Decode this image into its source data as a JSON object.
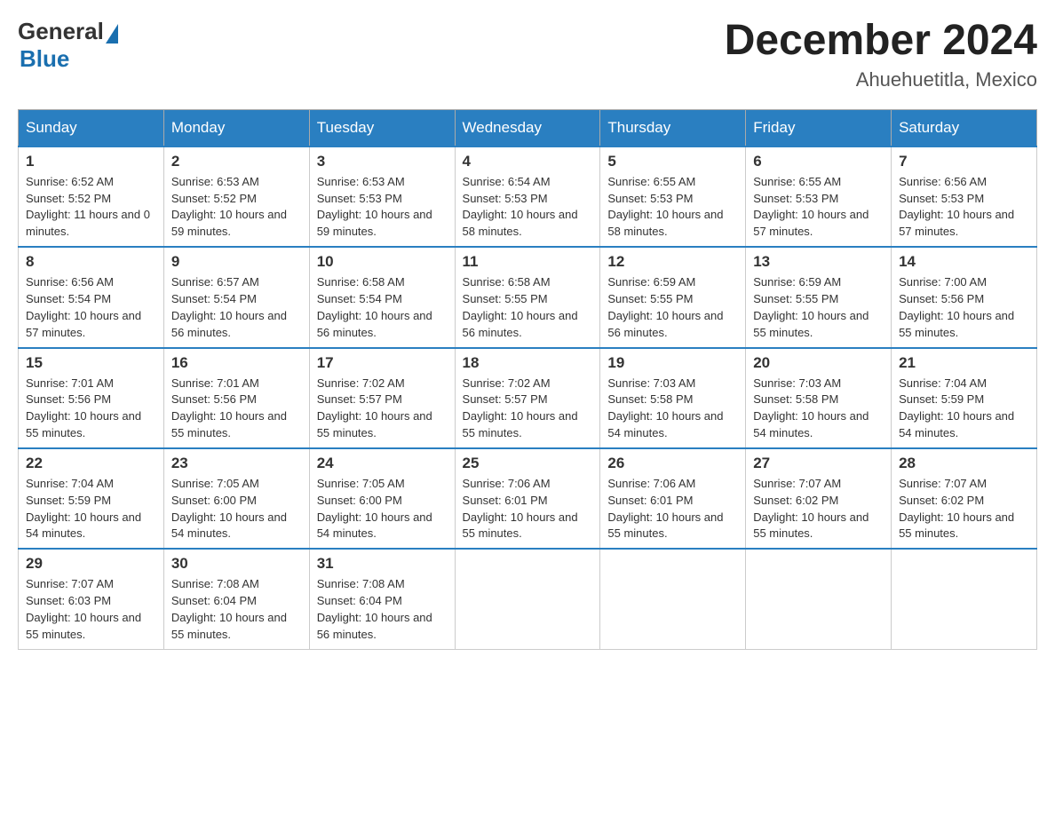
{
  "header": {
    "logo": {
      "general": "General",
      "blue": "Blue"
    },
    "title": "December 2024",
    "location": "Ahuehuetitla, Mexico"
  },
  "days_of_week": [
    "Sunday",
    "Monday",
    "Tuesday",
    "Wednesday",
    "Thursday",
    "Friday",
    "Saturday"
  ],
  "weeks": [
    [
      {
        "day": "1",
        "sunrise": "6:52 AM",
        "sunset": "5:52 PM",
        "daylight": "11 hours and 0 minutes."
      },
      {
        "day": "2",
        "sunrise": "6:53 AM",
        "sunset": "5:52 PM",
        "daylight": "10 hours and 59 minutes."
      },
      {
        "day": "3",
        "sunrise": "6:53 AM",
        "sunset": "5:53 PM",
        "daylight": "10 hours and 59 minutes."
      },
      {
        "day": "4",
        "sunrise": "6:54 AM",
        "sunset": "5:53 PM",
        "daylight": "10 hours and 58 minutes."
      },
      {
        "day": "5",
        "sunrise": "6:55 AM",
        "sunset": "5:53 PM",
        "daylight": "10 hours and 58 minutes."
      },
      {
        "day": "6",
        "sunrise": "6:55 AM",
        "sunset": "5:53 PM",
        "daylight": "10 hours and 57 minutes."
      },
      {
        "day": "7",
        "sunrise": "6:56 AM",
        "sunset": "5:53 PM",
        "daylight": "10 hours and 57 minutes."
      }
    ],
    [
      {
        "day": "8",
        "sunrise": "6:56 AM",
        "sunset": "5:54 PM",
        "daylight": "10 hours and 57 minutes."
      },
      {
        "day": "9",
        "sunrise": "6:57 AM",
        "sunset": "5:54 PM",
        "daylight": "10 hours and 56 minutes."
      },
      {
        "day": "10",
        "sunrise": "6:58 AM",
        "sunset": "5:54 PM",
        "daylight": "10 hours and 56 minutes."
      },
      {
        "day": "11",
        "sunrise": "6:58 AM",
        "sunset": "5:55 PM",
        "daylight": "10 hours and 56 minutes."
      },
      {
        "day": "12",
        "sunrise": "6:59 AM",
        "sunset": "5:55 PM",
        "daylight": "10 hours and 56 minutes."
      },
      {
        "day": "13",
        "sunrise": "6:59 AM",
        "sunset": "5:55 PM",
        "daylight": "10 hours and 55 minutes."
      },
      {
        "day": "14",
        "sunrise": "7:00 AM",
        "sunset": "5:56 PM",
        "daylight": "10 hours and 55 minutes."
      }
    ],
    [
      {
        "day": "15",
        "sunrise": "7:01 AM",
        "sunset": "5:56 PM",
        "daylight": "10 hours and 55 minutes."
      },
      {
        "day": "16",
        "sunrise": "7:01 AM",
        "sunset": "5:56 PM",
        "daylight": "10 hours and 55 minutes."
      },
      {
        "day": "17",
        "sunrise": "7:02 AM",
        "sunset": "5:57 PM",
        "daylight": "10 hours and 55 minutes."
      },
      {
        "day": "18",
        "sunrise": "7:02 AM",
        "sunset": "5:57 PM",
        "daylight": "10 hours and 55 minutes."
      },
      {
        "day": "19",
        "sunrise": "7:03 AM",
        "sunset": "5:58 PM",
        "daylight": "10 hours and 54 minutes."
      },
      {
        "day": "20",
        "sunrise": "7:03 AM",
        "sunset": "5:58 PM",
        "daylight": "10 hours and 54 minutes."
      },
      {
        "day": "21",
        "sunrise": "7:04 AM",
        "sunset": "5:59 PM",
        "daylight": "10 hours and 54 minutes."
      }
    ],
    [
      {
        "day": "22",
        "sunrise": "7:04 AM",
        "sunset": "5:59 PM",
        "daylight": "10 hours and 54 minutes."
      },
      {
        "day": "23",
        "sunrise": "7:05 AM",
        "sunset": "6:00 PM",
        "daylight": "10 hours and 54 minutes."
      },
      {
        "day": "24",
        "sunrise": "7:05 AM",
        "sunset": "6:00 PM",
        "daylight": "10 hours and 54 minutes."
      },
      {
        "day": "25",
        "sunrise": "7:06 AM",
        "sunset": "6:01 PM",
        "daylight": "10 hours and 55 minutes."
      },
      {
        "day": "26",
        "sunrise": "7:06 AM",
        "sunset": "6:01 PM",
        "daylight": "10 hours and 55 minutes."
      },
      {
        "day": "27",
        "sunrise": "7:07 AM",
        "sunset": "6:02 PM",
        "daylight": "10 hours and 55 minutes."
      },
      {
        "day": "28",
        "sunrise": "7:07 AM",
        "sunset": "6:02 PM",
        "daylight": "10 hours and 55 minutes."
      }
    ],
    [
      {
        "day": "29",
        "sunrise": "7:07 AM",
        "sunset": "6:03 PM",
        "daylight": "10 hours and 55 minutes."
      },
      {
        "day": "30",
        "sunrise": "7:08 AM",
        "sunset": "6:04 PM",
        "daylight": "10 hours and 55 minutes."
      },
      {
        "day": "31",
        "sunrise": "7:08 AM",
        "sunset": "6:04 PM",
        "daylight": "10 hours and 56 minutes."
      },
      null,
      null,
      null,
      null
    ]
  ],
  "labels": {
    "sunrise": "Sunrise:",
    "sunset": "Sunset:",
    "daylight": "Daylight:"
  }
}
